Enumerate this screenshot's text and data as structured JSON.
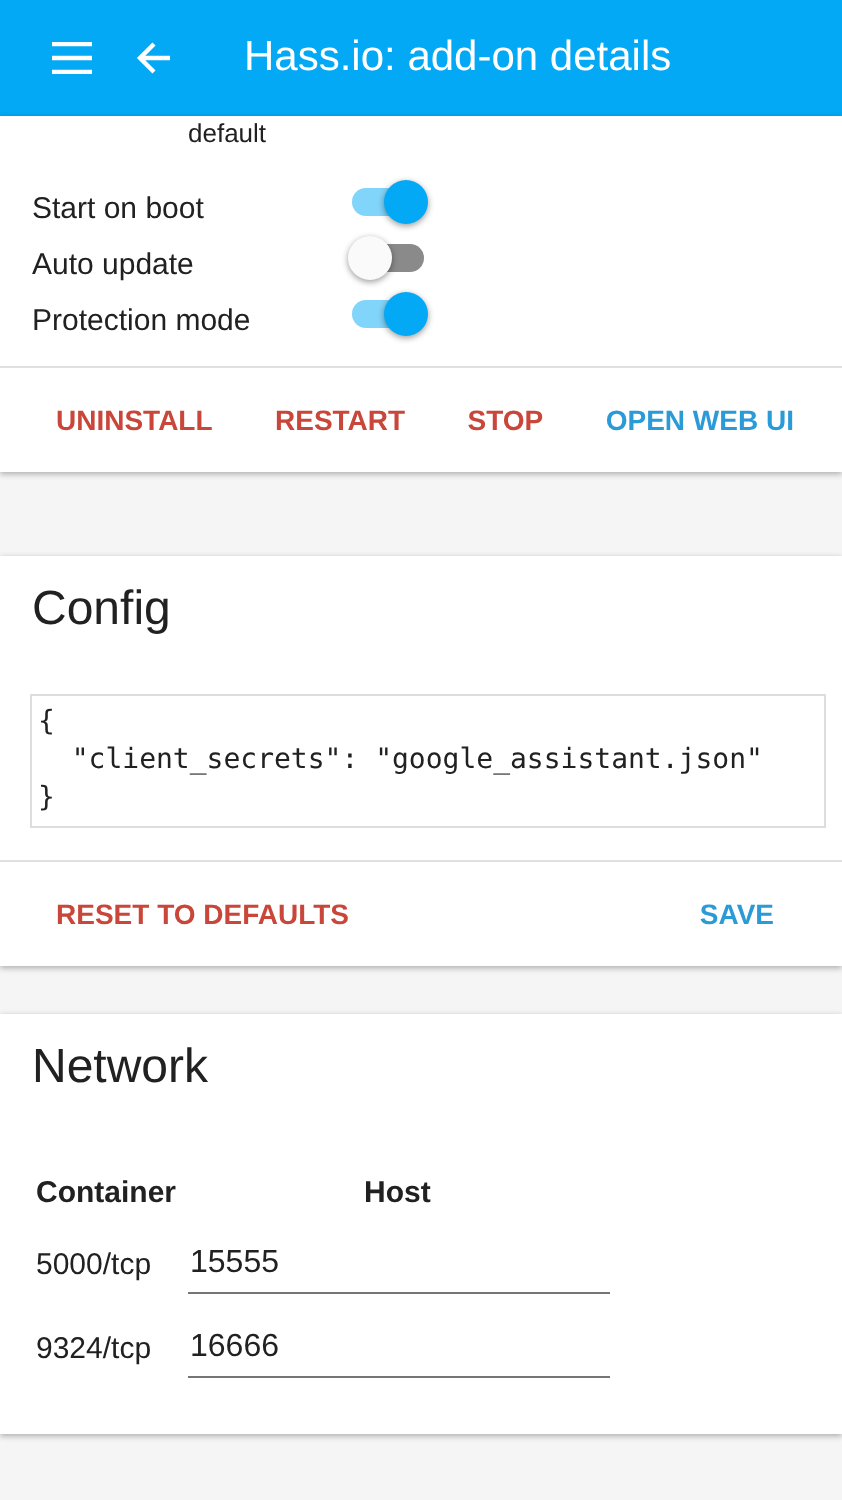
{
  "app_bar": {
    "title": "Hass.io: add-on details"
  },
  "info": {
    "text": "default"
  },
  "options": [
    {
      "label": "Start on boot",
      "on": true
    },
    {
      "label": "Auto update",
      "on": false
    },
    {
      "label": "Protection mode",
      "on": true
    }
  ],
  "actions": [
    {
      "label": "UNINSTALL",
      "kind": "danger"
    },
    {
      "label": "RESTART",
      "kind": "danger"
    },
    {
      "label": "STOP",
      "kind": "danger"
    },
    {
      "label": "OPEN WEB UI",
      "kind": "primary"
    }
  ],
  "config": {
    "title": "Config",
    "lines": [
      "{",
      "  \"client_secrets\": \"google_assistant.json\"",
      "}"
    ],
    "actions": [
      {
        "label": "RESET TO DEFAULTS",
        "kind": "danger"
      },
      {
        "label": "SAVE",
        "kind": "primary"
      }
    ]
  },
  "network": {
    "title": "Network",
    "columns": [
      "Container",
      "Host"
    ],
    "rows": [
      {
        "container": "5000/tcp",
        "host": "15555"
      },
      {
        "container": "9324/tcp",
        "host": "16666"
      }
    ]
  }
}
